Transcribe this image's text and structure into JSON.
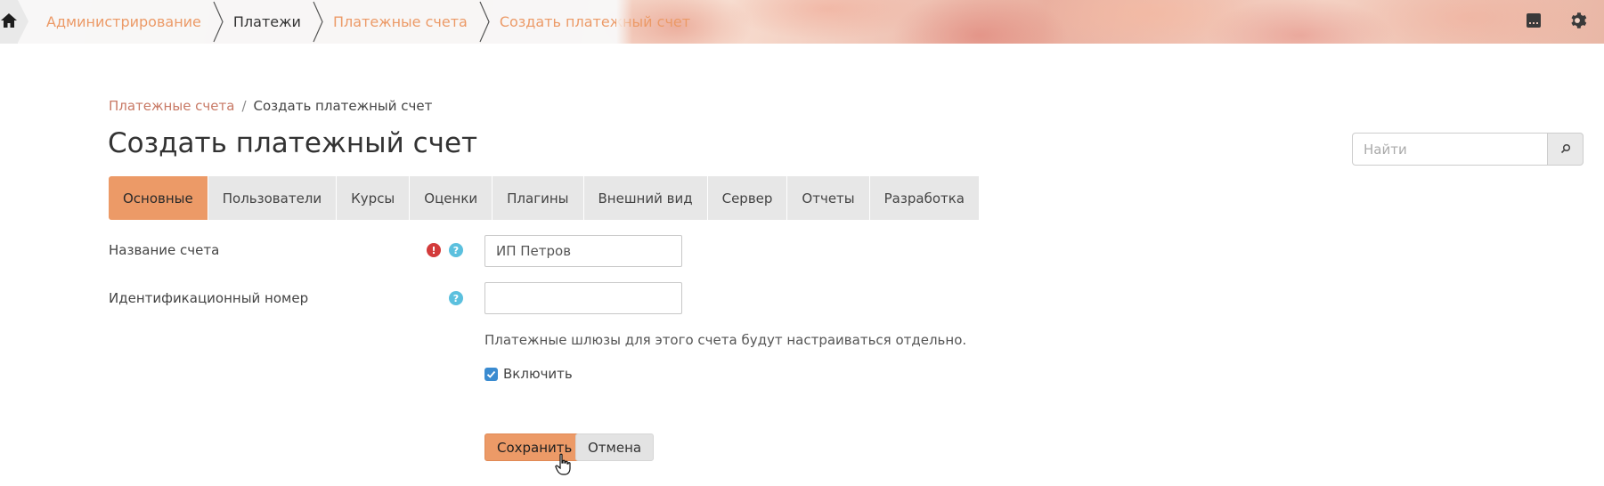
{
  "topnav": {
    "breadcrumbs": [
      {
        "label": "Администрирование"
      },
      {
        "label": "Платежи"
      },
      {
        "label": "Платежные счета"
      },
      {
        "label": "Создать платежный счет"
      }
    ]
  },
  "page": {
    "breadcrumb_link": "Платежные счета",
    "breadcrumb_sep": "/",
    "breadcrumb_current": "Создать платежный счет",
    "title": "Создать платежный счет"
  },
  "search": {
    "placeholder": "Найти",
    "value": ""
  },
  "tabs": [
    {
      "label": "Основные",
      "active": true
    },
    {
      "label": "Пользователи"
    },
    {
      "label": "Курсы"
    },
    {
      "label": "Оценки"
    },
    {
      "label": "Плагины"
    },
    {
      "label": "Внешний вид"
    },
    {
      "label": "Сервер"
    },
    {
      "label": "Отчеты"
    },
    {
      "label": "Разработка"
    }
  ],
  "form": {
    "account_name": {
      "label": "Название счета",
      "value": "ИП Петров",
      "required_icon": "!",
      "help_icon": "?"
    },
    "id_number": {
      "label": "Идентификационный номер",
      "value": "",
      "help_icon": "?"
    },
    "note": "Платежные шлюзы для этого счета будут настраиваться отдельно.",
    "enable": {
      "label": "Включить",
      "checked": true
    },
    "save_label": "Сохранить",
    "cancel_label": "Отмена"
  },
  "colors": {
    "accent": "#ec9a67",
    "link": "#c87965",
    "required": "#d33b3b",
    "help": "#5bc0de",
    "checkbox": "#3a8bd0"
  },
  "icons": [
    "home-icon",
    "save-draft-icon",
    "gear-icon",
    "search-icon",
    "cursor-hand-icon"
  ]
}
